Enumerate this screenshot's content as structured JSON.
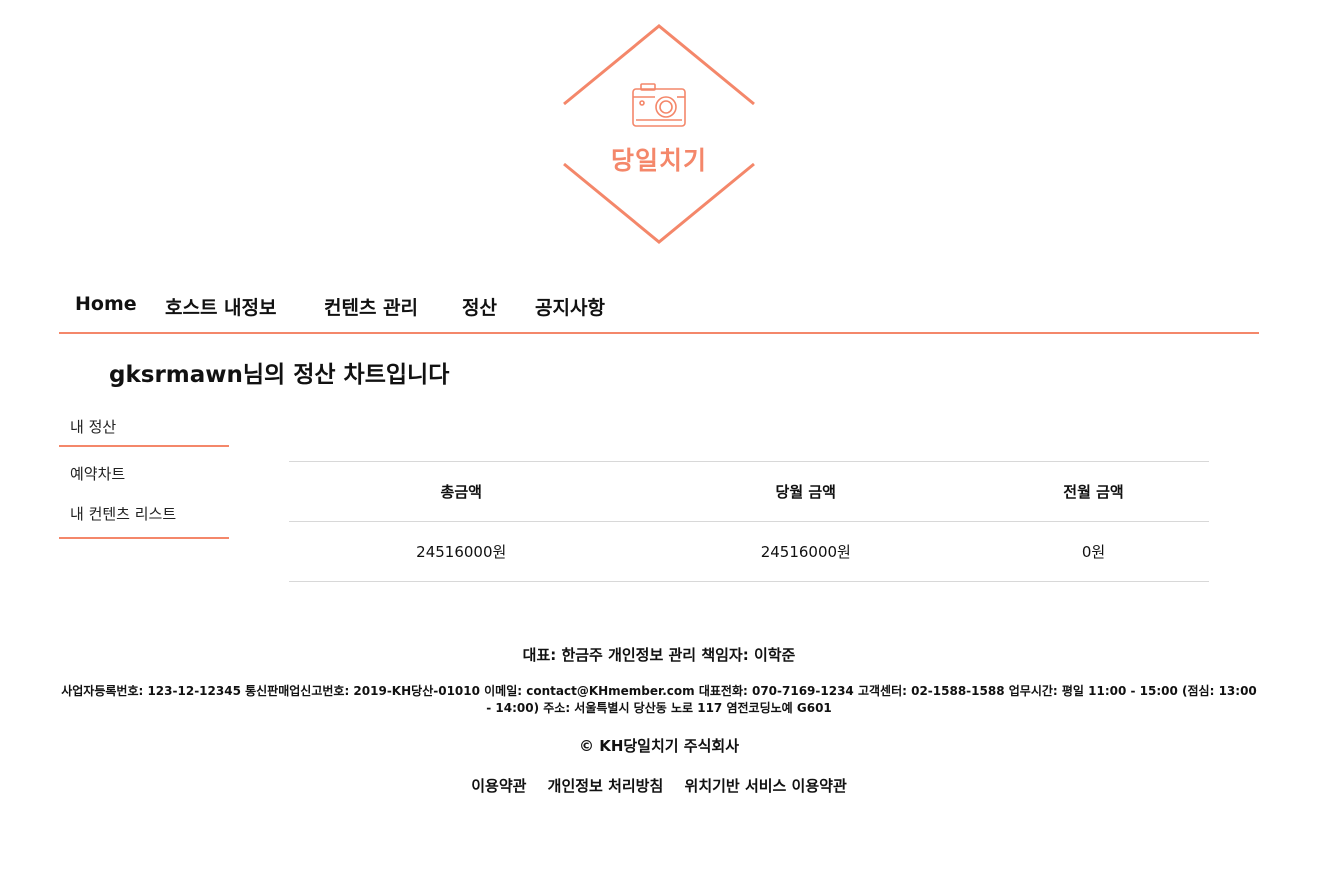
{
  "logo": {
    "text": "당일치기",
    "color": "#f4876a",
    "icon": "camera-icon"
  },
  "nav": {
    "items": [
      {
        "label": "Home"
      },
      {
        "label": "호스트 내정보"
      },
      {
        "label": "컨텐츠 관리"
      },
      {
        "label": "정산"
      },
      {
        "label": "공지사항"
      }
    ]
  },
  "page": {
    "heading": "gksrmawn님의 정산 차트입니다"
  },
  "side_menu": {
    "items": [
      {
        "label": "내 정산"
      },
      {
        "label": "예약차트"
      },
      {
        "label": "내 컨텐츠 리스트"
      }
    ]
  },
  "summary": {
    "headers": [
      "총금액",
      "당월 금액",
      "전월 금액"
    ],
    "values": [
      "24516000원",
      "24516000원",
      "0원"
    ]
  },
  "footer": {
    "representative": "대표: 한금주 개인정보 관리 책임자: 이학준",
    "info": "사업자등록번호: 123-12-12345 통신판매업신고번호: 2019-KH당산-01010 이메일: contact@KHmember.com 대표전화: 070-7169-1234 고객센터: 02-1588-1588 업무시간: 평일 11:00 - 15:00 (점심: 13:00 - 14:00) 주소: 서울특별시 당산동 노로 117 염전코딩노예 G601",
    "copyright": "© KH당일치기 주식회사",
    "links": [
      "이용약관",
      "개인정보 처리방침",
      "위치기반 서비스 이용약관"
    ]
  },
  "colors": {
    "accent": "#f4876a",
    "table_border": "#d8d8d8"
  }
}
